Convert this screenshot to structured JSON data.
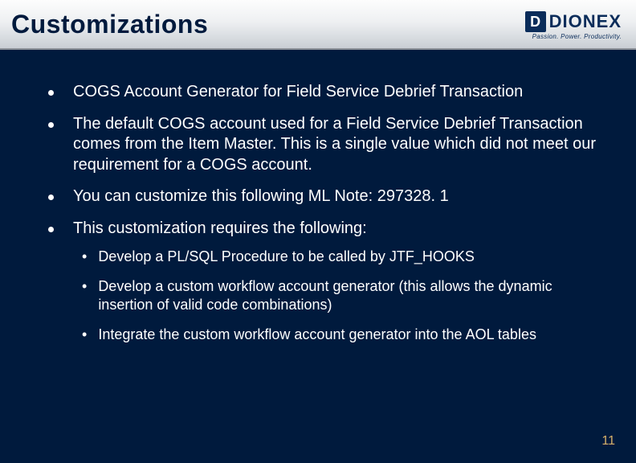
{
  "header": {
    "title": "Customizations",
    "logo": {
      "mark": "D",
      "name": "DIONEX",
      "tagline": "Passion. Power. Productivity."
    }
  },
  "bullets": [
    "COGS Account Generator for Field Service Debrief Transaction",
    "The default COGS account used for a Field Service Debrief Transaction comes from the Item Master.  This is a single value which did not meet our requirement for a COGS account.",
    "You can customize this following ML Note: 297328. 1",
    "This customization requires the following:"
  ],
  "sub_bullets": [
    "Develop a PL/SQL Procedure to be called by JTF_HOOKS",
    "Develop a custom workflow account generator (this allows the dynamic insertion of valid code combinations)",
    "Integrate the custom workflow account generator into the AOL tables"
  ],
  "page_number": "11"
}
